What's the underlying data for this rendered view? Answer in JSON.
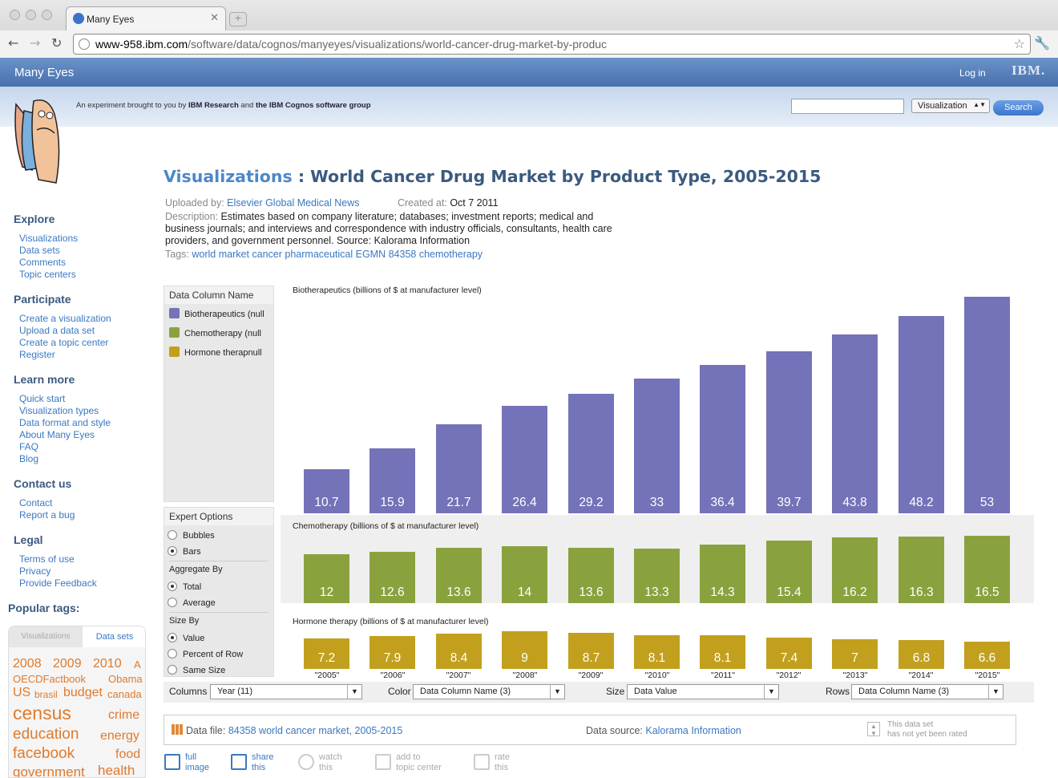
{
  "browser": {
    "tab_title": "Many Eyes",
    "url_host": "www-958.ibm.com",
    "url_path": "/software/data/cognos/manyeyes/visualizations/world-cancer-drug-market-by-produc"
  },
  "site": {
    "brand": "Many Eyes",
    "login": "Log in",
    "ibm": "IBM.",
    "tagline_pre": "An experiment brought to you by ",
    "tagline_b1": "IBM Research",
    "tagline_mid": " and ",
    "tagline_b2": "the IBM Cognos software group",
    "search_placeholder": "",
    "search_type": "Visualization",
    "search_button": "Search"
  },
  "sidebar": {
    "explore": {
      "heading": "Explore",
      "items": [
        "Visualizations",
        "Data sets",
        "Comments",
        "Topic centers"
      ]
    },
    "participate": {
      "heading": "Participate",
      "items": [
        "Create a visualization",
        "Upload a data set",
        "Create a topic center",
        "Register"
      ]
    },
    "learn": {
      "heading": "Learn more",
      "items": [
        "Quick start",
        "Visualization types",
        "Data format and style",
        "About Many Eyes",
        "FAQ",
        "Blog"
      ]
    },
    "contact": {
      "heading": "Contact us",
      "items": [
        "Contact",
        "Report a bug"
      ]
    },
    "legal": {
      "heading": "Legal",
      "items": [
        "Terms of use",
        "Privacy",
        "Provide Feedback"
      ]
    },
    "popular": {
      "heading": "Popular tags:",
      "tab_viz": "Visualizations",
      "tab_data": "Data sets",
      "tags": [
        "2008",
        "2009",
        "2010",
        "A",
        "OECDFactbook",
        "Obama",
        "US",
        "brasil",
        "budget",
        "canada",
        "census",
        "crime",
        "education",
        "energy",
        "facebook",
        "food",
        "government",
        "health"
      ]
    }
  },
  "page": {
    "title_link": "Visualizations",
    "title_sep": " : ",
    "title_text": "World Cancer Drug Market by Product Type, 2005-2015",
    "uploaded_label": "Uploaded by:",
    "uploaded_by": "Elsevier Global Medical News",
    "created_label": "Created at:",
    "created_at": "Oct 7 2011",
    "description_label": "Description:",
    "description_1": "Estimates based on company literature; databases; investment reports; medical and",
    "description_2": "business journals; and interviews and correspondence with industry officials, consultants, health care",
    "description_3": "providers, and government personnel. Source: Kalorama Information",
    "tags_label": "Tags:",
    "tags": "world market cancer pharmaceutical EGMN 84358 chemotherapy"
  },
  "controls": {
    "legend_header": "Data Column Name",
    "legend": [
      {
        "label": "Biotherapeutics (null",
        "color": "#7472b8"
      },
      {
        "label": "Chemotherapy (null",
        "color": "#8aa23e"
      },
      {
        "label": "Hormone therapnull",
        "color": "#c2a01e"
      }
    ],
    "expert_header": "Expert Options",
    "bubbles": "Bubbles",
    "bars": "Bars",
    "aggregate_label": "Aggregate By",
    "total": "Total",
    "average": "Average",
    "size_label": "Size By",
    "value": "Value",
    "percent_row": "Percent of Row",
    "same_size": "Same Size"
  },
  "chart_data": {
    "type": "bar",
    "categories": [
      "\"2005\"",
      "\"2006\"",
      "\"2007\"",
      "\"2008\"",
      "\"2009\"",
      "\"2010\"",
      "\"2011\"",
      "\"2012\"",
      "\"2013\"",
      "\"2014\"",
      "\"2015\""
    ],
    "series": [
      {
        "name": "Biotherapeutics (billions of $ at manufacturer level)",
        "color": "#7472b8",
        "values": [
          10.7,
          15.9,
          21.7,
          26.4,
          29.2,
          33,
          36.4,
          39.7,
          43.8,
          48.2,
          53
        ]
      },
      {
        "name": "Chemotherapy (billions of $ at manufacturer level)",
        "color": "#8aa23e",
        "values": [
          12,
          12.6,
          13.6,
          14,
          13.6,
          13.3,
          14.3,
          15.4,
          16.2,
          16.3,
          16.5
        ]
      },
      {
        "name": "Hormone therapy (billions of $ at manufacturer level)",
        "color": "#c2a01e",
        "values": [
          7.2,
          7.9,
          8.4,
          9,
          8.7,
          8.1,
          8.1,
          7.4,
          7,
          6.8,
          6.6
        ]
      }
    ]
  },
  "selectors": {
    "columns_label": "Columns",
    "columns_value": "Year (11)",
    "color_label": "Color",
    "color_value": "Data Column Name (3)",
    "size_label": "Size",
    "size_value": "Data Value",
    "rows_label": "Rows",
    "rows_value": "Data Column Name (3)"
  },
  "datafile": {
    "label": "Data file:",
    "name": "84358 world cancer market, 2005-2015",
    "source_label": "Data source:",
    "source": "Kalorama Information",
    "rating_1": "This data set",
    "rating_2": "has not yet been rated"
  },
  "actions": [
    {
      "l1": "full",
      "l2": "image"
    },
    {
      "l1": "share",
      "l2": "this"
    },
    {
      "l1": "watch",
      "l2": "this"
    },
    {
      "l1": "add to",
      "l2": "topic center"
    },
    {
      "l1": "rate",
      "l2": "this"
    }
  ]
}
